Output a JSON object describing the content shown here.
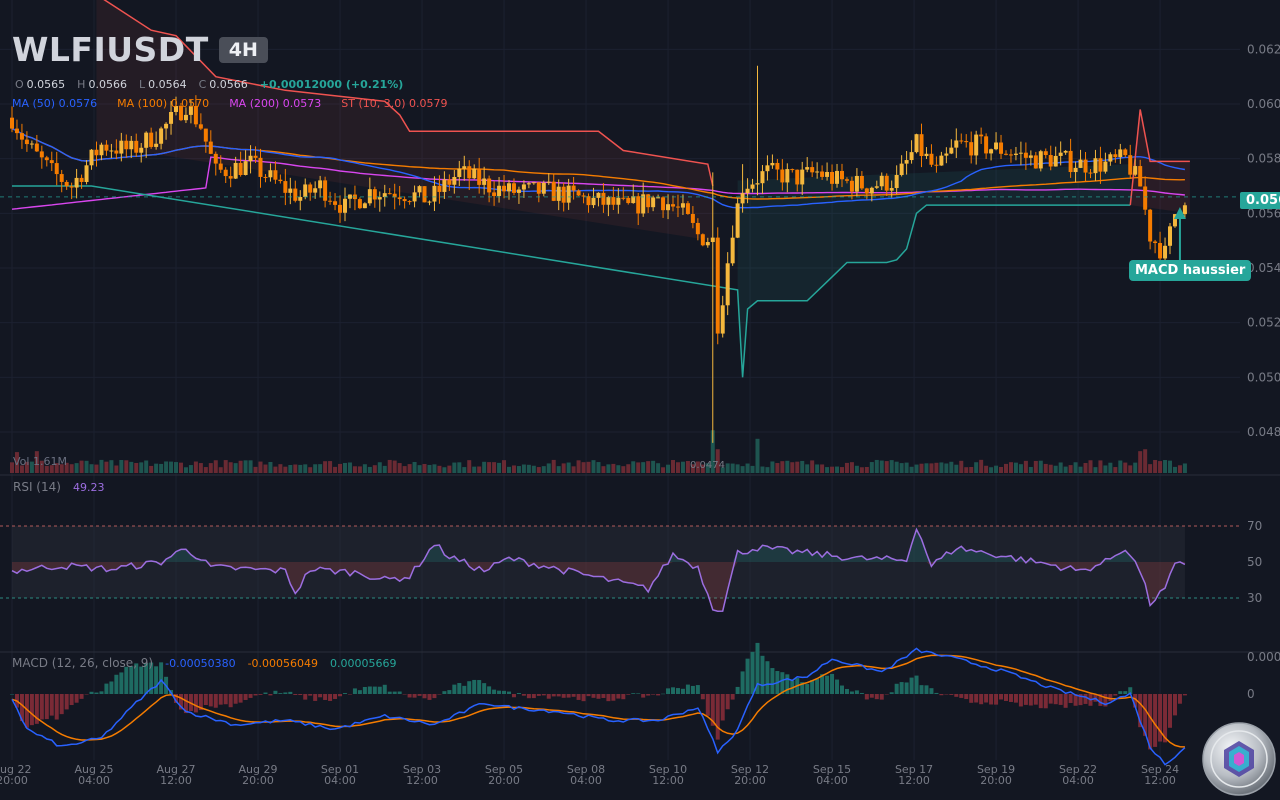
{
  "header": {
    "symbol": "WLFIUSDT",
    "timeframe": "4H",
    "ohlc": {
      "o_label": "O",
      "o": "0.0565",
      "h_label": "H",
      "h": "0.0566",
      "l_label": "L",
      "l": "0.0564",
      "c_label": "C",
      "c": "0.0566",
      "change": "+0.00012000 (+0.21%)"
    },
    "indicators": [
      {
        "label": "MA (50)",
        "value": "0.0576",
        "color": "#2962ff"
      },
      {
        "label": "MA (100)",
        "value": "0.0570",
        "color": "#f57c00"
      },
      {
        "label": "MA (200)",
        "value": "0.0573",
        "color": "#d946ef"
      },
      {
        "label": "ST (10, 3.0)",
        "value": "0.0579",
        "color": "#ef5350"
      }
    ]
  },
  "volume": {
    "label": "Vol",
    "value": "1.61M",
    "last_value": "0.0474"
  },
  "rsi": {
    "label": "RSI (14)",
    "value": "49.23",
    "levels": [
      70,
      50,
      30
    ]
  },
  "macd": {
    "label": "MACD (12, 26, close, 9)",
    "macd_value": "-0.00050380",
    "signal_value": "-0.00056049",
    "hist_value": "0.00005669",
    "axis_labels": [
      "0.000",
      "0"
    ]
  },
  "price_tag": "0.056",
  "callout": "MACD haussier",
  "colors": {
    "up": "#f5b83d",
    "down": "#f57c00",
    "bg": "#131722",
    "teal": "#26a69a",
    "red": "#ef5350"
  },
  "chart_data": {
    "type": "candlestick",
    "price_axis": {
      "ylim": [
        0.0465,
        0.063
      ],
      "tick_labels": [
        "0.062",
        "0.060",
        "0.058",
        "0.056",
        "0.054",
        "0.052",
        "0.050",
        "0.048"
      ]
    },
    "x_ticks": [
      [
        "Aug 22",
        "20:00"
      ],
      [
        "Aug 25",
        "04:00"
      ],
      [
        "Aug 27",
        "12:00"
      ],
      [
        "Aug 29",
        "20:00"
      ],
      [
        "Sep 01",
        "04:00"
      ],
      [
        "Sep 03",
        "12:00"
      ],
      [
        "Sep 05",
        "20:00"
      ],
      [
        "Sep 08",
        "04:00"
      ],
      [
        "Sep 10",
        "12:00"
      ],
      [
        "Sep 12",
        "20:00"
      ],
      [
        "Sep 15",
        "04:00"
      ],
      [
        "Sep 17",
        "12:00"
      ],
      [
        "Sep 19",
        "20:00"
      ],
      [
        "Sep 22",
        "04:00"
      ],
      [
        "Sep 24",
        "12:00"
      ]
    ],
    "close_anchors": [
      [
        0,
        0.0595
      ],
      [
        3,
        0.0585
      ],
      [
        8,
        0.0575
      ],
      [
        12,
        0.057
      ],
      [
        18,
        0.0585
      ],
      [
        24,
        0.0583
      ],
      [
        30,
        0.059
      ],
      [
        35,
        0.06
      ],
      [
        38,
        0.0592
      ],
      [
        41,
        0.0575
      ],
      [
        48,
        0.0578
      ],
      [
        54,
        0.057
      ],
      [
        58,
        0.0566
      ],
      [
        62,
        0.057
      ],
      [
        67,
        0.0562
      ],
      [
        72,
        0.0568
      ],
      [
        78,
        0.0568
      ],
      [
        84,
        0.0565
      ],
      [
        90,
        0.0575
      ],
      [
        96,
        0.057
      ],
      [
        100,
        0.0568
      ],
      [
        108,
        0.0568
      ],
      [
        116,
        0.0565
      ],
      [
        124,
        0.0562
      ],
      [
        130,
        0.0566
      ],
      [
        135,
        0.056
      ],
      [
        138,
        0.0552
      ],
      [
        141,
        0.055
      ],
      [
        142,
        0.052
      ],
      [
        143,
        0.053
      ],
      [
        145,
        0.0555
      ],
      [
        147,
        0.057
      ],
      [
        152,
        0.0575
      ],
      [
        158,
        0.0573
      ],
      [
        162,
        0.0575
      ],
      [
        166,
        0.0572
      ],
      [
        172,
        0.057
      ],
      [
        178,
        0.0572
      ],
      [
        182,
        0.0585
      ],
      [
        186,
        0.0575
      ],
      [
        190,
        0.0585
      ],
      [
        194,
        0.0585
      ],
      [
        200,
        0.0583
      ],
      [
        205,
        0.058
      ],
      [
        210,
        0.058
      ],
      [
        215,
        0.0578
      ],
      [
        220,
        0.0578
      ],
      [
        224,
        0.058
      ],
      [
        227,
        0.057
      ],
      [
        229,
        0.0552
      ],
      [
        232,
        0.0545
      ],
      [
        234,
        0.056
      ],
      [
        236,
        0.0566
      ]
    ],
    "volume_spikes": [
      [
        1,
        2.2
      ],
      [
        5,
        2.3
      ],
      [
        141,
        4.5
      ],
      [
        142,
        2.5
      ],
      [
        150,
        3.6
      ],
      [
        227,
        2.3
      ],
      [
        228,
        2.5
      ]
    ],
    "supertrend": {
      "upper": [
        [
          17,
          0.064
        ],
        [
          28,
          0.0627
        ],
        [
          33,
          0.0625
        ],
        [
          41,
          0.061
        ],
        [
          55,
          0.0605
        ],
        [
          75,
          0.0601
        ],
        [
          78,
          0.0596
        ],
        [
          80,
          0.059
        ],
        [
          118,
          0.059
        ],
        [
          123,
          0.0583
        ],
        [
          140,
          0.0578
        ],
        [
          141,
          0.057
        ]
      ],
      "lower": [
        [
          0,
          0.057
        ],
        [
          16,
          0.057
        ],
        [
          146,
          0.0532
        ],
        [
          147,
          0.05
        ],
        [
          148,
          0.0525
        ],
        [
          150,
          0.0528
        ],
        [
          160,
          0.0528
        ],
        [
          164,
          0.0535
        ],
        [
          168,
          0.0542
        ],
        [
          176,
          0.0542
        ],
        [
          178,
          0.0543
        ],
        [
          180,
          0.0547
        ],
        [
          182,
          0.056
        ],
        [
          184,
          0.0563
        ],
        [
          225,
          0.0563
        ]
      ],
      "upper2": [
        [
          225,
          0.0563
        ],
        [
          227,
          0.0598
        ],
        [
          229,
          0.0579
        ],
        [
          237,
          0.0579
        ]
      ]
    },
    "rsi_anchors": [
      [
        0,
        45
      ],
      [
        10,
        48
      ],
      [
        20,
        46
      ],
      [
        30,
        50
      ],
      [
        35,
        58
      ],
      [
        40,
        47
      ],
      [
        55,
        45
      ],
      [
        57,
        33
      ],
      [
        60,
        46
      ],
      [
        70,
        44
      ],
      [
        75,
        40
      ],
      [
        80,
        42
      ],
      [
        85,
        60
      ],
      [
        88,
        53
      ],
      [
        95,
        45
      ],
      [
        100,
        52
      ],
      [
        110,
        46
      ],
      [
        120,
        40
      ],
      [
        128,
        35
      ],
      [
        133,
        54
      ],
      [
        138,
        47
      ],
      [
        141,
        25
      ],
      [
        143,
        24
      ],
      [
        146,
        55
      ],
      [
        150,
        58
      ],
      [
        160,
        55
      ],
      [
        170,
        52
      ],
      [
        180,
        51
      ],
      [
        182,
        70
      ],
      [
        185,
        48
      ],
      [
        190,
        58
      ],
      [
        200,
        53
      ],
      [
        210,
        48
      ],
      [
        215,
        45
      ],
      [
        220,
        50
      ],
      [
        224,
        58
      ],
      [
        227,
        45
      ],
      [
        229,
        27
      ],
      [
        232,
        35
      ],
      [
        234,
        48
      ],
      [
        236,
        49
      ]
    ],
    "macd_anchors": [
      [
        0,
        -0.0001
      ],
      [
        3,
        -0.0008
      ],
      [
        10,
        -0.0012
      ],
      [
        18,
        -0.001
      ],
      [
        25,
        -0.0002
      ],
      [
        30,
        0.0003
      ],
      [
        35,
        -0.0004
      ],
      [
        45,
        -0.0007
      ],
      [
        55,
        -0.0006
      ],
      [
        65,
        -0.0008
      ],
      [
        75,
        -0.0005
      ],
      [
        85,
        -0.0007
      ],
      [
        95,
        -0.0002
      ],
      [
        100,
        -0.0003
      ],
      [
        110,
        -0.0004
      ],
      [
        120,
        -0.0006
      ],
      [
        130,
        -0.0006
      ],
      [
        138,
        -0.0003
      ],
      [
        142,
        -0.0013
      ],
      [
        145,
        -0.001
      ],
      [
        150,
        0.0002
      ],
      [
        160,
        0.0004
      ],
      [
        165,
        0.0008
      ],
      [
        175,
        0.0005
      ],
      [
        182,
        0.001
      ],
      [
        190,
        0.0008
      ],
      [
        200,
        0.0005
      ],
      [
        210,
        0.0001
      ],
      [
        220,
        -0.0002
      ],
      [
        225,
        0.0
      ],
      [
        229,
        -0.0012
      ],
      [
        232,
        -0.0016
      ],
      [
        236,
        -0.0012
      ]
    ]
  }
}
